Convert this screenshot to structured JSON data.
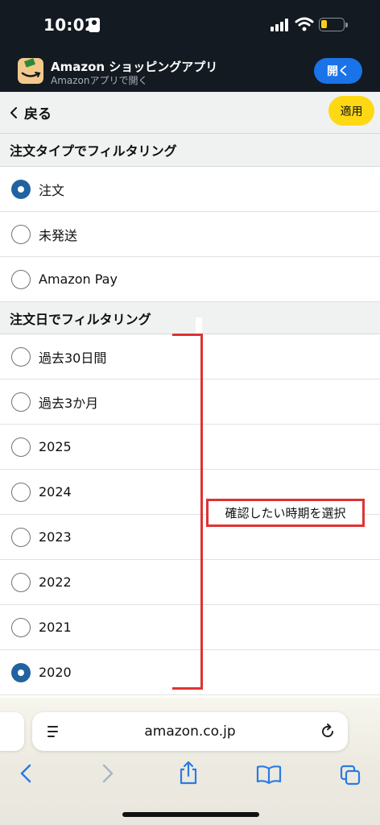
{
  "status_bar": {
    "time": "10:02",
    "battery_level": 0.28
  },
  "app_banner": {
    "title": "Amazon ショッピングアプリ",
    "subtitle": "Amazonアプリで開く",
    "open_label": "開く"
  },
  "header": {
    "back_label": "戻る",
    "apply_label": "適用"
  },
  "order_type": {
    "heading": "注文タイプでフィルタリング",
    "options": [
      {
        "label": "注文",
        "checked": true
      },
      {
        "label": "未発送",
        "checked": false
      },
      {
        "label": "Amazon Pay",
        "checked": false
      }
    ]
  },
  "order_date": {
    "heading": "注文日でフィルタリング",
    "options": [
      {
        "label": "過去30日間",
        "checked": false
      },
      {
        "label": "過去3か月",
        "checked": false
      },
      {
        "label": "2025",
        "checked": false
      },
      {
        "label": "2024",
        "checked": false
      },
      {
        "label": "2023",
        "checked": false
      },
      {
        "label": "2022",
        "checked": false
      },
      {
        "label": "2021",
        "checked": false
      },
      {
        "label": "2020",
        "checked": true
      }
    ]
  },
  "annotation": {
    "text": "確認したい時期を選択",
    "color": "#e03232"
  },
  "browser": {
    "url": "amazon.co.jp"
  },
  "colors": {
    "accent_blue": "#1a73e8",
    "radio_checked": "#2162a1",
    "apply_yellow": "#ffd814",
    "dark_bar": "#131a22"
  }
}
